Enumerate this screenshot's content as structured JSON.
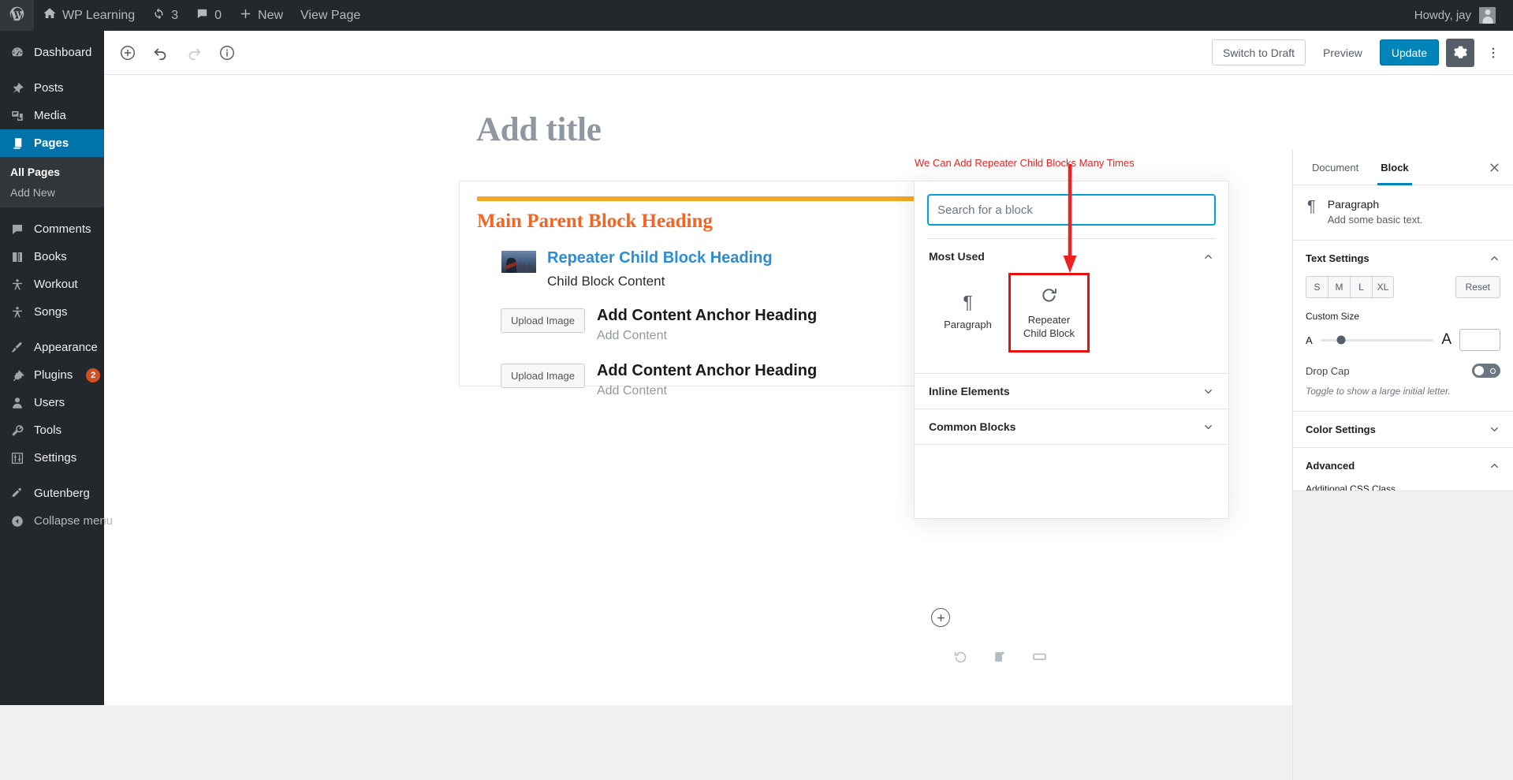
{
  "adminbar": {
    "logo_icon": "wordpress-logo-icon",
    "site_icon": "home-icon",
    "site_name": "WP Learning",
    "updates_icon": "updates-icon",
    "updates_count": "3",
    "comments_icon": "comment-bubble-icon",
    "comments_count": "0",
    "new_icon": "plus-icon",
    "new_label": "New",
    "view_page_label": "View Page",
    "howdy": "Howdy, jay"
  },
  "adminmenu": {
    "items": [
      {
        "label": "Dashboard",
        "icon": "dashboard-icon",
        "name": "dashboard"
      },
      {
        "label": "Posts",
        "icon": "pin-icon",
        "name": "posts"
      },
      {
        "label": "Media",
        "icon": "media-icon",
        "name": "media"
      },
      {
        "label": "Pages",
        "icon": "page-icon",
        "name": "pages",
        "current": true
      },
      {
        "label": "Comments",
        "icon": "comment-bubble-icon",
        "name": "comments"
      },
      {
        "label": "Books",
        "icon": "book-icon",
        "name": "books"
      },
      {
        "label": "Workout",
        "icon": "person-icon",
        "name": "workout"
      },
      {
        "label": "Songs",
        "icon": "person-icon",
        "name": "songs"
      },
      {
        "label": "Appearance",
        "icon": "brush-icon",
        "name": "appearance"
      },
      {
        "label": "Plugins",
        "icon": "plug-icon",
        "name": "plugins",
        "badge": "2"
      },
      {
        "label": "Users",
        "icon": "user-icon",
        "name": "users"
      },
      {
        "label": "Tools",
        "icon": "wrench-icon",
        "name": "tools"
      },
      {
        "label": "Settings",
        "icon": "sliders-icon",
        "name": "settings"
      },
      {
        "label": "Gutenberg",
        "icon": "pencil-icon",
        "name": "gutenberg"
      },
      {
        "label": "Collapse menu",
        "icon": "collapse-arrow-icon",
        "name": "collapse-menu"
      }
    ],
    "submenu": [
      {
        "label": "All Pages",
        "current": true
      },
      {
        "label": "Add New",
        "current": false
      }
    ]
  },
  "editor_header": {
    "inserter_icon": "add-block-icon",
    "undo_icon": "undo-icon",
    "redo_icon": "redo-icon",
    "info_icon": "content-info-icon",
    "switch_to_draft_label": "Switch to Draft",
    "preview_label": "Preview",
    "update_label": "Update",
    "settings_icon": "gear-icon",
    "more_icon": "ellipsis-vertical-icon"
  },
  "canvas": {
    "title_placeholder": "Add title",
    "parent_heading": "Main Parent Block Heading",
    "child": {
      "thumbnail": "harry-potter-thumbnail-image",
      "heading": "Repeater Child Block Heading",
      "content": "Child Block Content"
    },
    "anchors": [
      {
        "upload_label": "Upload Image",
        "heading": "Add Content Anchor Heading",
        "content": "Add Content"
      },
      {
        "upload_label": "Upload Image",
        "heading": "Add Content Anchor Heading",
        "content": "Add Content"
      }
    ],
    "appender_icon": "circle-plus-icon",
    "block_tools": [
      {
        "icon": "reset-rotate-icon",
        "name": "reset-block"
      },
      {
        "icon": "duplicate-block-icon",
        "name": "duplicate-block"
      },
      {
        "icon": "full-width-icon",
        "name": "block-width"
      }
    ]
  },
  "annotation": {
    "text": "We Can Add Repeater Child Blocks Many Times",
    "color": "#ee2222"
  },
  "inserter": {
    "search_placeholder": "Search for a block",
    "search_value": "",
    "panels": [
      {
        "label": "Most Used",
        "expanded": true
      },
      {
        "label": "Inline Elements",
        "expanded": false
      },
      {
        "label": "Common Blocks",
        "expanded": false
      }
    ],
    "tiles": [
      {
        "label": "Paragraph",
        "icon": "paragraph-pilcrow-icon",
        "highlighted": false
      },
      {
        "label": "Repeater Child Block",
        "icon": "loop-rotate-icon",
        "highlighted": true
      }
    ],
    "highlight_color": "#e8100f",
    "focus_color": "#00a0d2"
  },
  "settings_sidebar": {
    "tabs": [
      {
        "label": "Document",
        "active": false
      },
      {
        "label": "Block",
        "active": true
      }
    ],
    "close_icon": "close-icon",
    "block_card": {
      "icon": "paragraph-pilcrow-icon",
      "title": "Paragraph",
      "description": "Add some basic text."
    },
    "text_settings": {
      "label": "Text Settings",
      "expanded": true,
      "sizes": [
        "S",
        "M",
        "L",
        "XL"
      ],
      "reset_label": "Reset",
      "custom_size_label": "Custom Size",
      "slider_small_letter": "A",
      "slider_large_letter": "A",
      "custom_size_value": "",
      "drop_cap_label": "Drop Cap",
      "drop_cap_on": false,
      "drop_cap_help": "Toggle to show a large initial letter."
    },
    "color_settings": {
      "label": "Color Settings",
      "expanded": false
    },
    "advanced": {
      "label": "Advanced",
      "expanded": true,
      "css_class_label": "Additional CSS Class",
      "css_class_value": ""
    }
  },
  "colors": {
    "admin_dark": "#23282d",
    "admin_current": "#0073aa",
    "primary_button": "#0085ba",
    "parent_heading": "#f26522",
    "parent_rule": "#f5a623",
    "child_heading": "#2b8dd6",
    "annotation_red": "#ee2222"
  }
}
